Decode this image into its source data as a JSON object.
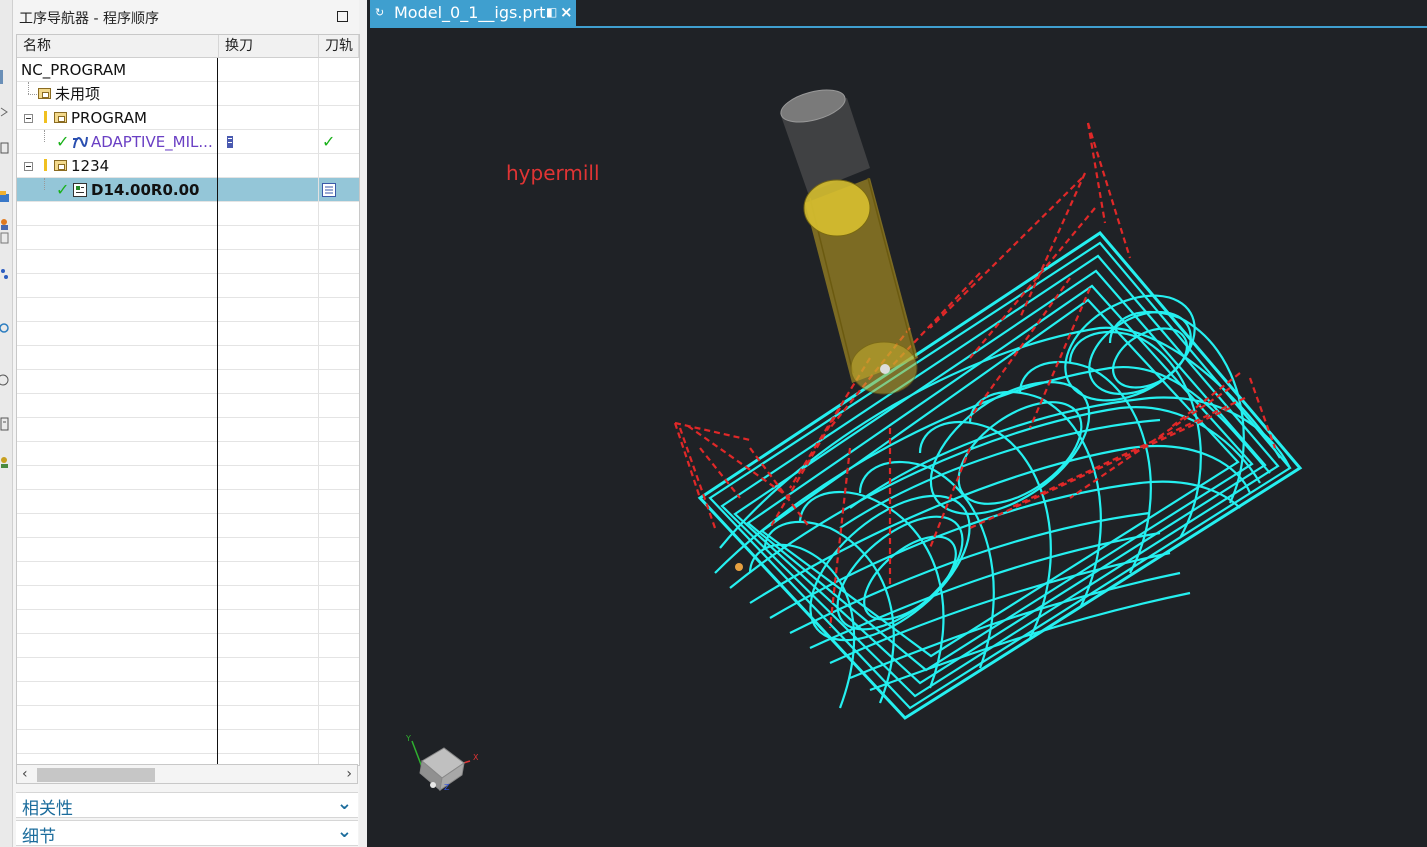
{
  "navigator": {
    "title": "工序导航器 - 程序顺序",
    "columns": {
      "name": "名称",
      "tool_change": "换刀",
      "toolpath": "刀轨"
    },
    "rows": [
      {
        "name": "NC_PROGRAM"
      },
      {
        "name": "未用项"
      },
      {
        "name": "PROGRAM"
      },
      {
        "name": "ADAPTIVE_MIL..."
      },
      {
        "name": "1234"
      },
      {
        "name": "D14.00R0.00"
      }
    ],
    "toolpath_check": "✓",
    "sections": {
      "relations": "相关性",
      "details": "细节"
    }
  },
  "viewport": {
    "tab_label": "Model_0_1__igs.prt",
    "tab_close": "×",
    "annotation": "hypermill",
    "triad_axes": {
      "x": "X",
      "y": "Y",
      "z": "Z"
    }
  },
  "colors": {
    "tab_blue": "#3f9fcf",
    "viewport_bg": "#1f2226",
    "toolpath_cyan": "#25f0f0",
    "rapid_red": "#e02828",
    "selection": "#94c6d8",
    "section_text": "#1b6c9c",
    "operation_purple": "#6a3fc4"
  },
  "icons": [
    "maximize-icon",
    "folder-icon",
    "check-icon",
    "operation-icon",
    "tool-icon",
    "toolpath-list-icon",
    "chevron-down-icon",
    "close-icon",
    "pin-icon",
    "axis-triad-icon"
  ]
}
